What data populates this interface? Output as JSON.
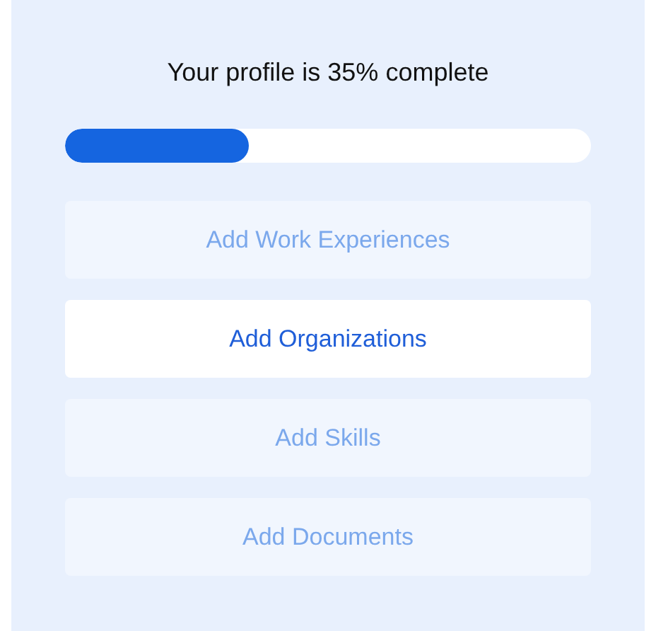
{
  "title": "Your profile is 35% complete",
  "progress": {
    "level": 0.35
  },
  "actions": [
    {
      "label": "Add Work Experiences",
      "selected": false
    },
    {
      "label": "Add Organizations",
      "selected": true
    },
    {
      "label": "Add Skills",
      "selected": false
    },
    {
      "label": "Add Documents",
      "selected": false
    }
  ]
}
